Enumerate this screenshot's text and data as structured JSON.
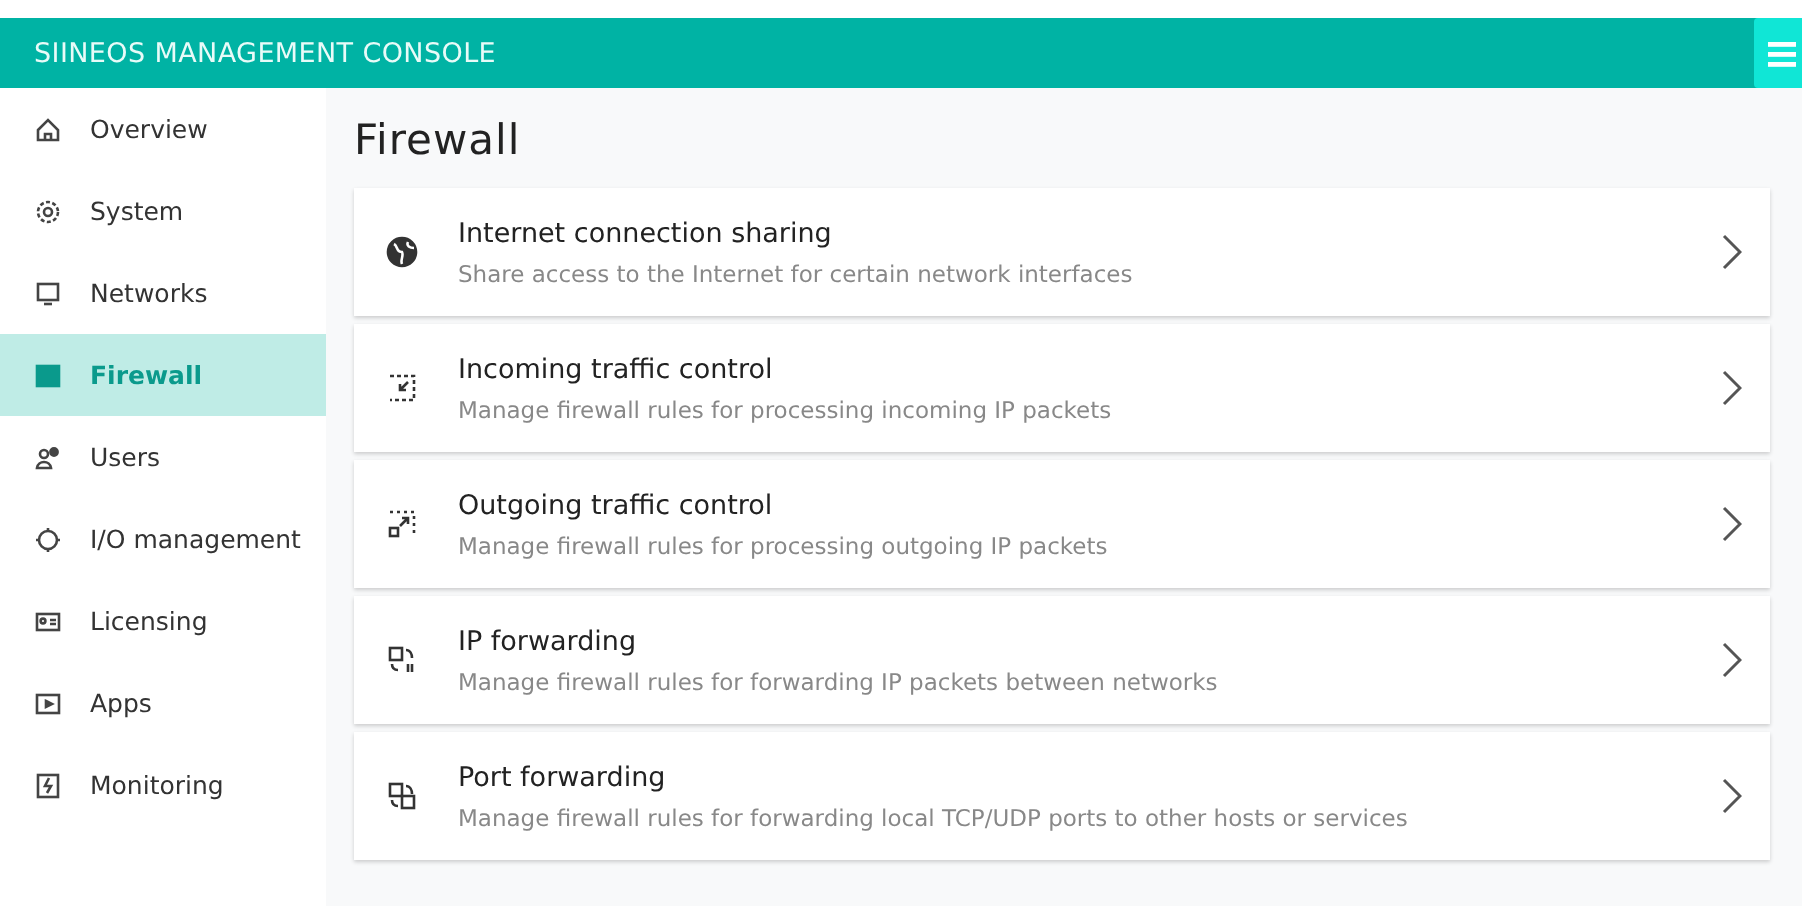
{
  "header": {
    "title": "SIINEOS MANAGEMENT CONSOLE"
  },
  "sidebar": {
    "items": [
      {
        "label": "Overview",
        "selected": false
      },
      {
        "label": "System",
        "selected": false
      },
      {
        "label": "Networks",
        "selected": false
      },
      {
        "label": "Firewall",
        "selected": true
      },
      {
        "label": "Users",
        "selected": false
      },
      {
        "label": "I/O management",
        "selected": false
      },
      {
        "label": "Licensing",
        "selected": false
      },
      {
        "label": "Apps",
        "selected": false
      },
      {
        "label": "Monitoring",
        "selected": false
      }
    ]
  },
  "page": {
    "title": "Firewall"
  },
  "cards": [
    {
      "title": "Internet connection sharing",
      "description": "Share access to the Internet for certain network interfaces"
    },
    {
      "title": "Incoming traffic control",
      "description": "Manage firewall rules for processing incoming IP packets"
    },
    {
      "title": "Outgoing traffic control",
      "description": "Manage firewall rules for processing outgoing IP packets"
    },
    {
      "title": "IP forwarding",
      "description": "Manage firewall rules for forwarding IP packets between networks"
    },
    {
      "title": "Port forwarding",
      "description": "Manage firewall rules for forwarding local TCP/UDP ports to other hosts or services"
    }
  ]
}
